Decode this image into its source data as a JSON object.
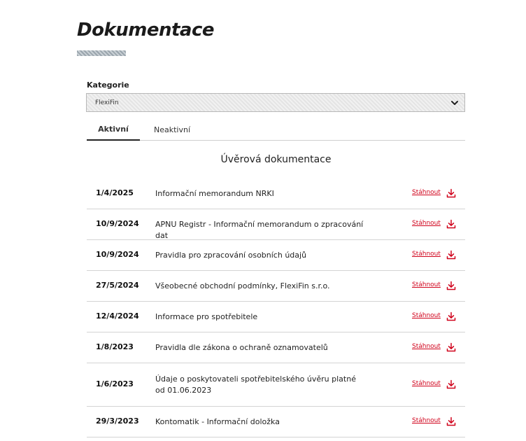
{
  "page": {
    "title": "Dokumentace"
  },
  "filter": {
    "label": "Kategorie",
    "selected": "FlexiFin"
  },
  "tabs": [
    {
      "label": "Aktivní",
      "active": true
    },
    {
      "label": "Neaktivní",
      "active": false
    }
  ],
  "section": {
    "title": "Úvěrová dokumentace"
  },
  "documents": [
    {
      "date": "1/4/2025",
      "name": "Informační memorandum NRKI",
      "link": "Stáhnout"
    },
    {
      "date": "10/9/2024",
      "name": "APNU Registr - Informační memorandum o zpracování dat",
      "link": "Stáhnout"
    },
    {
      "date": "10/9/2024",
      "name": "Pravidla pro zpracování osobních údajů",
      "link": "Stáhnout"
    },
    {
      "date": "27/5/2024",
      "name": "Všeobecné obchodní podmínky, FlexiFin s.r.o.",
      "link": "Stáhnout"
    },
    {
      "date": "12/4/2024",
      "name": "Informace pro spotřebitele",
      "link": "Stáhnout"
    },
    {
      "date": "1/8/2023",
      "name": "Pravidla dle zákona o ochraně oznamovatelů",
      "link": "Stáhnout"
    },
    {
      "date": "1/6/2023",
      "name": "Údaje o poskytovateli spotřebitelského úvěru platné od 01.06.2023",
      "link": "Stáhnout"
    },
    {
      "date": "29/3/2023",
      "name": "Kontomatik - Informační doložka",
      "link": "Stáhnout"
    }
  ],
  "colors": {
    "link": "#d0021b",
    "icon": "download-icon"
  }
}
